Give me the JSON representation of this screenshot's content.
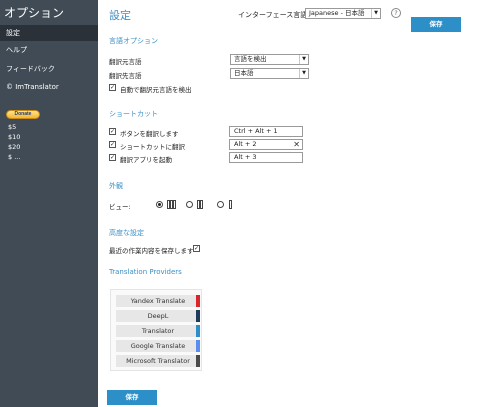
{
  "sidebar": {
    "title": "オプション",
    "items": [
      {
        "label": "設定",
        "active": true
      },
      {
        "label": "ヘルプ",
        "active": false
      },
      {
        "label": "フィードバック",
        "active": false
      },
      {
        "label": "© ImTranslator",
        "active": false
      }
    ],
    "donate_label": "Donate",
    "amounts": [
      "$5",
      "$10",
      "$20",
      "$ ..."
    ]
  },
  "header": {
    "title": "設定",
    "interface_language_label": "インターフェース言語",
    "interface_language_value": "Japanese - 日本語",
    "help_icon": "?",
    "save_label": "保存"
  },
  "language_options": {
    "title": "言語オプション",
    "source_label": "翻訳元言語",
    "source_value": "言語を検出",
    "target_label": "翻訳先言語",
    "target_value": "日本語",
    "auto_detect_label": "自動で翻訳元言語を検出",
    "auto_detect_checked": true
  },
  "shortcuts": {
    "title": "ショートカット",
    "items": [
      {
        "label": "ボタンを翻訳します",
        "checked": true,
        "value": "Ctrl + Alt + 1"
      },
      {
        "label": "ショートカットに翻訳",
        "checked": true,
        "value": "Alt + 2",
        "clear": "✕"
      },
      {
        "label": "翻訳アプリを起動",
        "checked": true,
        "value": "Alt + 3"
      }
    ]
  },
  "appearance": {
    "title": "外観",
    "view_label": "ビュー:",
    "selected_view": 1
  },
  "advanced": {
    "title": "高度な設定",
    "save_recent_label": "最近の作業内容を保存します",
    "save_recent_checked": true
  },
  "providers": {
    "title": "Translation Providers",
    "items": [
      {
        "name": "Yandex Translate",
        "color": "#d9262b"
      },
      {
        "name": "DeepL",
        "color": "#1f3b5c"
      },
      {
        "name": "Translator",
        "color": "#2e8fc8"
      },
      {
        "name": "Google Translate",
        "color": "#5b8def"
      },
      {
        "name": "Microsoft Translator",
        "color": "#4a4a4a"
      }
    ]
  },
  "footer": {
    "save_label": "保存"
  }
}
